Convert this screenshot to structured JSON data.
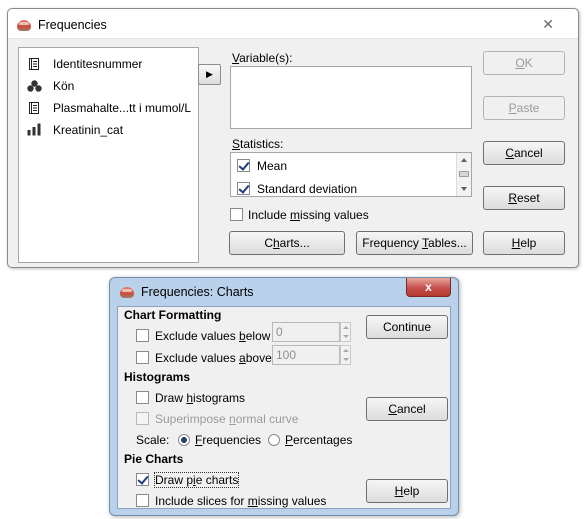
{
  "frequencies_window": {
    "title": "Frequencies",
    "close_glyph": "✕",
    "variables_source": [
      {
        "label": "Identitesnummer",
        "icon": "string-variable-icon"
      },
      {
        "label": "Kön",
        "icon": "nominal-variable-icon"
      },
      {
        "label": "Plasmahalte...tt i mumol/L",
        "icon": "string-variable-icon"
      },
      {
        "label": "Kreatinin_cat",
        "icon": "ordinal-variable-icon"
      }
    ],
    "move_glyph": "▶",
    "variables_label": {
      "u": "V",
      "rest": "ariable(s):"
    },
    "statistics_label": {
      "u": "S",
      "rest": "tatistics:"
    },
    "statistics_items": [
      {
        "label": "Mean",
        "checked": true
      },
      {
        "label": "Standard deviation",
        "checked": true
      }
    ],
    "include_missing": {
      "pre": "Include ",
      "u": "m",
      "post": "issing values",
      "checked": false
    },
    "buttons": {
      "ok": {
        "u": "O",
        "rest": "K"
      },
      "paste": {
        "u": "P",
        "rest": "aste"
      },
      "cancel": {
        "u": "C",
        "rest": "ancel"
      },
      "reset": {
        "u": "R",
        "rest": "eset"
      },
      "help": {
        "u": "H",
        "rest": "elp"
      },
      "charts": {
        "pre": "C",
        "u": "h",
        "post": "arts..."
      },
      "frequency_tables": {
        "pre": "Frequency ",
        "u": "T",
        "post": "ables..."
      }
    }
  },
  "charts_dialog": {
    "title": "Frequencies: Charts",
    "close_glyph": "x",
    "chart_formatting": {
      "heading": "Chart Formatting",
      "exclude_below": {
        "pre": "Exclude values ",
        "u": "b",
        "post": "elow",
        "value": "0",
        "checked": false
      },
      "exclude_above": {
        "pre": "Exclude values ",
        "u": "a",
        "post": "bove",
        "value": "100",
        "checked": false
      }
    },
    "histograms": {
      "heading": "Histograms",
      "draw_histograms": {
        "pre": "Draw ",
        "u": "h",
        "post": "istograms",
        "checked": false
      },
      "superimpose": {
        "pre": "Superimpose ",
        "u": "n",
        "post": "ormal curve",
        "checked": false,
        "disabled": true
      },
      "scale_label": "Scale:",
      "scale_frequencies": {
        "u": "F",
        "rest": "requencies",
        "selected": true
      },
      "scale_percentages": {
        "u": "P",
        "rest": "ercentages",
        "selected": false
      }
    },
    "pie_charts": {
      "heading": "Pie Charts",
      "draw_pie": {
        "pre": "Draw p",
        "u": "i",
        "post": "e charts",
        "checked": true
      },
      "include_slices": {
        "pre": "Include slices for ",
        "u": "m",
        "post": "issing values",
        "checked": false
      }
    },
    "buttons": {
      "continue": "Continue",
      "cancel": {
        "u": "C",
        "rest": "ancel"
      },
      "help": {
        "u": "H",
        "rest": "elp"
      }
    }
  }
}
